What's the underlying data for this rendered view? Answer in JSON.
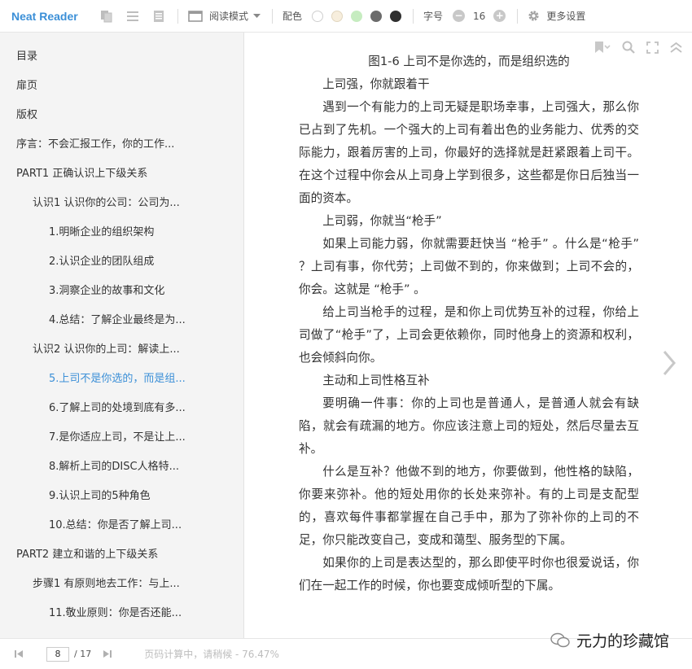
{
  "app": {
    "brand": "Neat Reader"
  },
  "toolbar": {
    "read_mode_label": "阅读模式",
    "color_label": "配色",
    "colors": [
      "#ffffff",
      "#f7eedd",
      "#c6ecc0",
      "#6b6b6b",
      "#2f2f2f"
    ],
    "font_size_label": "字号",
    "font_size_value": "16",
    "more_settings_label": "更多设置"
  },
  "toc": {
    "items": [
      {
        "label": "目录",
        "level": 0
      },
      {
        "label": "扉页",
        "level": 0
      },
      {
        "label": "版权",
        "level": 0
      },
      {
        "label": "序言：不会汇报工作，你的工作...",
        "level": 0
      },
      {
        "label": "PART1 正确认识上下级关系",
        "level": 0
      },
      {
        "label": "认识1 认识你的公司：公司为...",
        "level": 1
      },
      {
        "label": "1.明晰企业的组织架构",
        "level": 2
      },
      {
        "label": "2.认识企业的团队组成",
        "level": 2
      },
      {
        "label": "3.洞察企业的故事和文化",
        "level": 2
      },
      {
        "label": "4.总结：了解企业最终是为...",
        "level": 2
      },
      {
        "label": "认识2 认识你的上司：解读上...",
        "level": 1
      },
      {
        "label": "5.上司不是你选的，而是组...",
        "level": 2,
        "active": true
      },
      {
        "label": "6.了解上司的处境到底有多...",
        "level": 2
      },
      {
        "label": "7.是你适应上司，不是让上...",
        "level": 2
      },
      {
        "label": "8.解析上司的DISC人格特...",
        "level": 2
      },
      {
        "label": "9.认识上司的5种角色",
        "level": 2
      },
      {
        "label": "10.总结：你是否了解上司...",
        "level": 2
      },
      {
        "label": "PART2 建立和谐的上下级关系",
        "level": 0
      },
      {
        "label": "步骤1 有原则地去工作：与上...",
        "level": 1
      },
      {
        "label": "11.敬业原则：你是否还能...",
        "level": 2
      }
    ]
  },
  "content": {
    "caption": "图1-6 上司不是你选的，而是组织选的",
    "paragraphs": [
      "上司强，你就跟着干",
      "遇到一个有能力的上司无疑是职场幸事，上司强大，那么你已占到了先机。一个强大的上司有着出色的业务能力、优秀的交际能力，跟着厉害的上司，你最好的选择就是赶紧跟着上司干。在这个过程中你会从上司身上学到很多，这些都是你日后独当一面的资本。",
      "上司弱，你就当“枪手”",
      "如果上司能力弱，你就需要赶快当 “枪手” 。什么是“枪手” ？上司有事，你代劳；上司做不到的，你来做到；上司不会的，你会。这就是 “枪手” 。",
      "给上司当枪手的过程，是和你上司优势互补的过程，你给上司做了“枪手”了，上司会更依赖你，同时他身上的资源和权利，也会倾斜向你。",
      "主动和上司性格互补",
      "要明确一件事：你的上司也是普通人，是普通人就会有缺陷，就会有疏漏的地方。你应该注意上司的短处，然后尽量去互补。",
      "什么是互补？他做不到的地方，你要做到，他性格的缺陷，你要来弥补。他的短处用你的长处来弥补。有的上司是支配型的，喜欢每件事都掌握在自己手中，那为了弥补你的上司的不足，你只能改变自己，变成和蔼型、服务型的下属。",
      "如果你的上司是表达型的，那么即使平时你也很爱说话，你们在一起工作的时候，你也要变成倾听型的下属。"
    ]
  },
  "footer": {
    "page_current": "8",
    "page_total": "/ 17",
    "status": "页码计算中，请稍候 - 76.47%"
  },
  "watermark": {
    "text": "元力的珍藏馆"
  }
}
